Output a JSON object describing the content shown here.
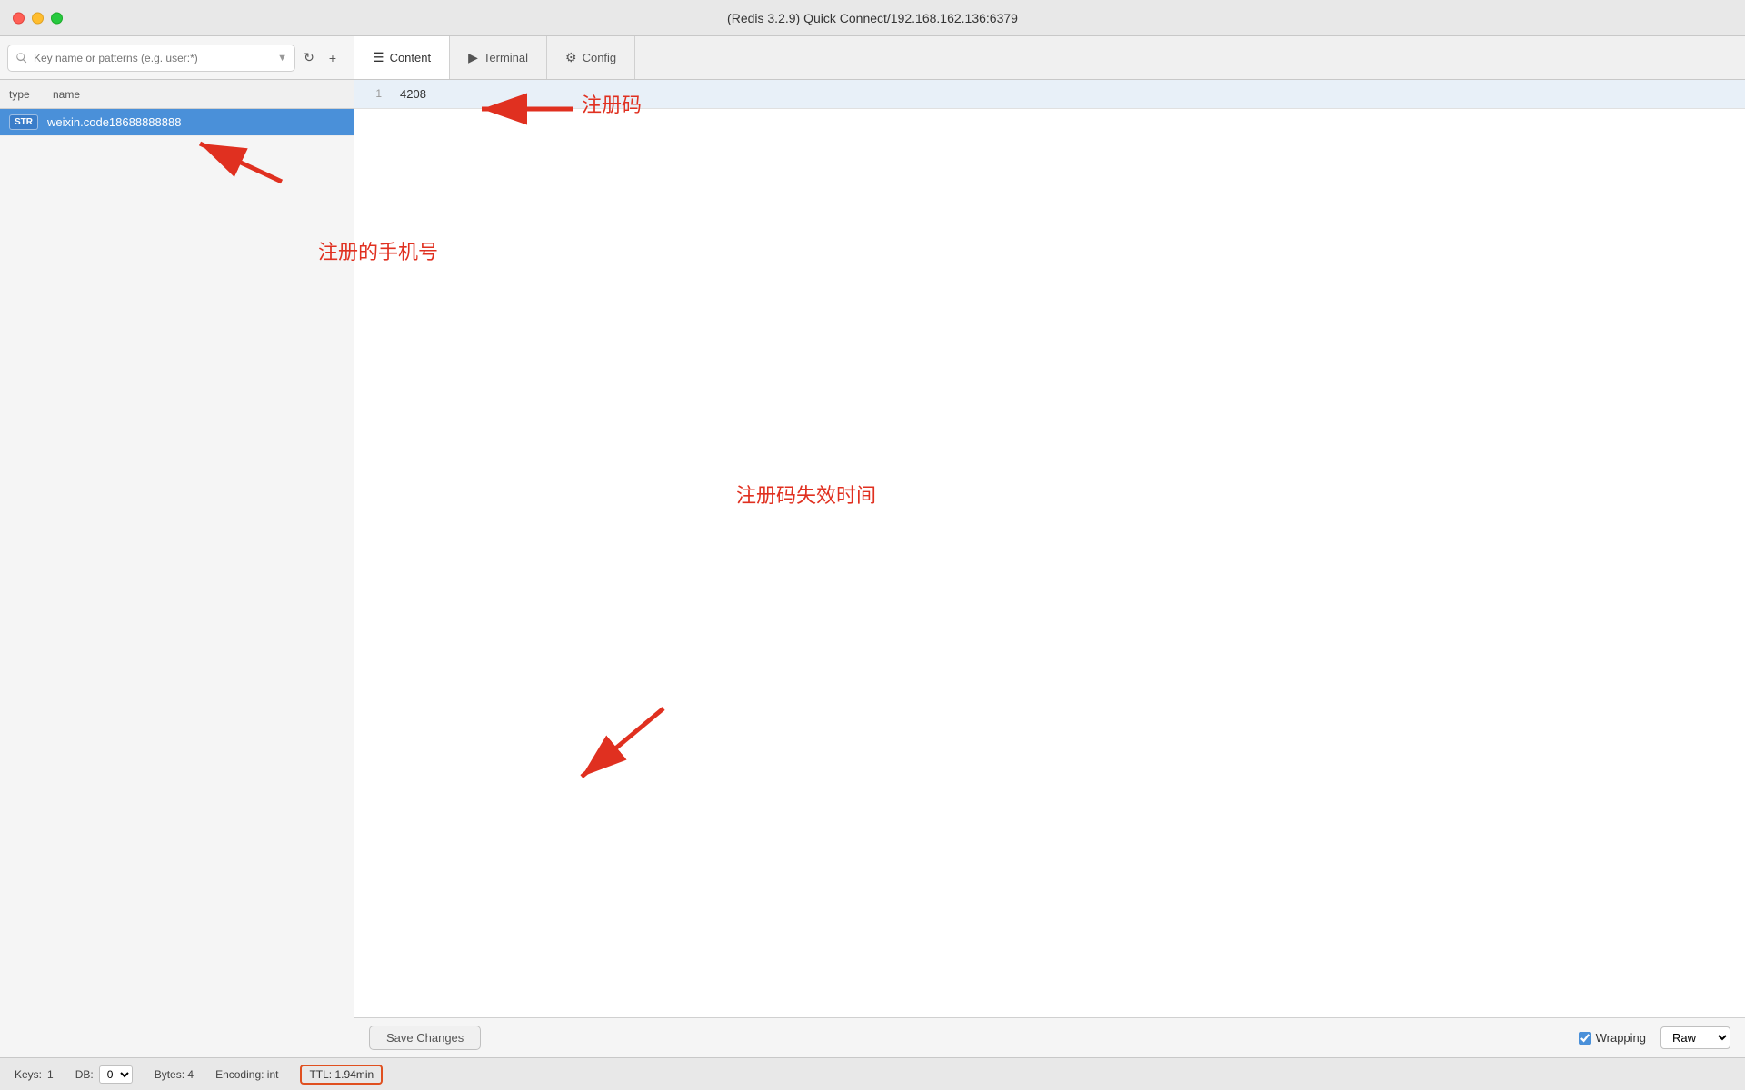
{
  "titlebar": {
    "title": "(Redis 3.2.9) Quick Connect/192.168.162.136:6379"
  },
  "search": {
    "placeholder": "Key name or patterns (e.g. user:*)"
  },
  "key_list": {
    "col_type": "type",
    "col_name": "name",
    "items": [
      {
        "type": "STR",
        "name": "weixin.code18688888888",
        "selected": true
      }
    ]
  },
  "tabs": [
    {
      "label": "Content",
      "icon": "☰",
      "active": true
    },
    {
      "label": "Terminal",
      "icon": "▶",
      "active": false
    },
    {
      "label": "Config",
      "icon": "⚙",
      "active": false
    }
  ],
  "value_area": {
    "row_num": "1",
    "row_value": "4208"
  },
  "bottom_toolbar": {
    "save_label": "Save Changes",
    "wrapping_label": "Wrapping",
    "raw_option": "Raw"
  },
  "statusbar": {
    "keys_label": "Keys:",
    "keys_count": "1",
    "db_label": "DB:",
    "db_value": "0",
    "bytes_label": "Bytes: 4",
    "encoding_label": "Encoding: int",
    "ttl_label": "TTL: 1.94min"
  },
  "annotations": {
    "register_code_text": "注册码",
    "register_phone_text": "注册的手机号",
    "register_expire_text": "注册码失效时间"
  }
}
